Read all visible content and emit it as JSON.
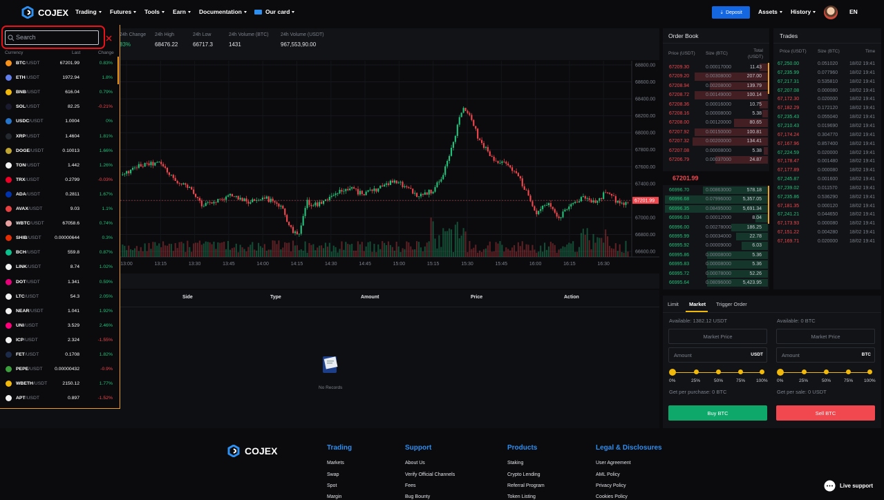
{
  "brand": {
    "name": "COJEX"
  },
  "nav": {
    "items": [
      "Trading",
      "Futures",
      "Tools",
      "Earn",
      "Documentation",
      "Our card"
    ],
    "deposit": "Deposit",
    "assets": "Assets",
    "history": "History",
    "lang": "EN"
  },
  "ticker": {
    "change_label": "24h Change",
    "change_value": "83%",
    "high_label": "24h High",
    "high_value": "68476.22",
    "low_label": "24h Low",
    "low_value": "66717.3",
    "volbtc_label": "24h Volume (BTC)",
    "volbtc_value": "1431",
    "volusdt_label": "24h Volume (USDT)",
    "volusdt_value": "967,553,90.00"
  },
  "chart": {
    "price_ticks": [
      "68800.00",
      "68600.00",
      "68400.00",
      "68200.00",
      "68000.00",
      "67800.00",
      "67600.00",
      "67400.00",
      "67200.00",
      "67000.00",
      "66800.00",
      "66600.00"
    ],
    "time_ticks": [
      "13:00",
      "13:15",
      "13:30",
      "13:45",
      "14:00",
      "14:15",
      "14:30",
      "14:45",
      "15:00",
      "15:15",
      "15:30",
      "15:45",
      "16:00",
      "16:15",
      "16:30"
    ],
    "last_price": "67201.99"
  },
  "orders_table": {
    "headers": [
      "Side",
      "Type",
      "Amount",
      "Price",
      "Action"
    ],
    "empty_text": "No Records"
  },
  "orderbook": {
    "title": "Order Book",
    "h_price": "Price (USDT)",
    "h_size": "Size (BTC)",
    "h_total": "Total (USDT)",
    "asks": [
      {
        "p": "67209.30",
        "s": "0.00017000",
        "t": "11.43",
        "d": 0.08
      },
      {
        "p": "67209.20",
        "s": "0.00308000",
        "t": "207.00",
        "d": 0.7
      },
      {
        "p": "67208.94",
        "s": "0.00208000",
        "t": "139.79",
        "d": 0.55
      },
      {
        "p": "67208.72",
        "s": "0.00149000",
        "t": "100.14",
        "d": 0.7
      },
      {
        "p": "67208.36",
        "s": "0.00016000",
        "t": "10.75",
        "d": 0.08
      },
      {
        "p": "67208.16",
        "s": "0.00008000",
        "t": "5.38",
        "d": 0.05
      },
      {
        "p": "67208.00",
        "s": "0.00120000",
        "t": "80.65",
        "d": 0.32
      },
      {
        "p": "67207.92",
        "s": "0.00150000",
        "t": "100.81",
        "d": 0.7
      },
      {
        "p": "67207.32",
        "s": "0.00200000",
        "t": "134.41",
        "d": 0.72
      },
      {
        "p": "67207.08",
        "s": "0.00008000",
        "t": "5.38",
        "d": 0.04
      },
      {
        "p": "67206.79",
        "s": "0.00037000",
        "t": "24.87",
        "d": 0.5
      }
    ],
    "mid": "67201.99",
    "bids": [
      {
        "p": "66996.70",
        "s": "0.00863000",
        "t": "578.18",
        "d": 0.62
      },
      {
        "p": "66996.68",
        "s": "0.07996000",
        "t": "5,357.05",
        "d": 0.98
      },
      {
        "p": "66996.35",
        "s": "0.08495000",
        "t": "5,691.34",
        "d": 0.98
      },
      {
        "p": "66996.03",
        "s": "0.00012000",
        "t": "8.04",
        "d": 0.12
      },
      {
        "p": "66996.00",
        "s": "0.00278000",
        "t": "186.25",
        "d": 0.35
      },
      {
        "p": "66995.99",
        "s": "0.00034000",
        "t": "22.78",
        "d": 0.3
      },
      {
        "p": "66995.92",
        "s": "0.00009000",
        "t": "6.03",
        "d": 0.25
      },
      {
        "p": "66995.86",
        "s": "0.00008000",
        "t": "5.36",
        "d": 0.58
      },
      {
        "p": "66995.83",
        "s": "0.00008000",
        "t": "5.36",
        "d": 0.58
      },
      {
        "p": "66995.72",
        "s": "0.00078000",
        "t": "52.26",
        "d": 0.58
      },
      {
        "p": "66995.64",
        "s": "0.08096000",
        "t": "5,423.95",
        "d": 0.58
      }
    ]
  },
  "trades": {
    "title": "Trades",
    "h_price": "Price (USDT)",
    "h_size": "Size (BTC)",
    "h_time": "Time",
    "rows": [
      {
        "p": "67,250.00",
        "s": "0.051020",
        "t": "18/02 19:41",
        "side": "buy"
      },
      {
        "p": "67,235.99",
        "s": "0.077960",
        "t": "18/02 19:41",
        "side": "buy"
      },
      {
        "p": "67,217.31",
        "s": "0.535810",
        "t": "18/02 19:41",
        "side": "buy"
      },
      {
        "p": "67,207.08",
        "s": "0.000080",
        "t": "18/02 19:41",
        "side": "buy"
      },
      {
        "p": "67,172.30",
        "s": "0.020000",
        "t": "18/02 19:41",
        "side": "sell"
      },
      {
        "p": "67,182.29",
        "s": "0.172120",
        "t": "18/02 19:41",
        "side": "sell"
      },
      {
        "p": "67,235.43",
        "s": "0.055040",
        "t": "18/02 19:41",
        "side": "buy"
      },
      {
        "p": "67,210.43",
        "s": "0.019690",
        "t": "18/02 19:41",
        "side": "buy"
      },
      {
        "p": "67,174.24",
        "s": "0.304770",
        "t": "18/02 19:41",
        "side": "sell"
      },
      {
        "p": "67,167.96",
        "s": "0.857400",
        "t": "18/02 19:41",
        "side": "sell"
      },
      {
        "p": "67,224.59",
        "s": "0.020000",
        "t": "18/02 19:41",
        "side": "buy"
      },
      {
        "p": "67,178.47",
        "s": "0.001480",
        "t": "18/02 19:41",
        "side": "sell"
      },
      {
        "p": "67,177.89",
        "s": "0.000080",
        "t": "18/02 19:41",
        "side": "sell"
      },
      {
        "p": "67,245.87",
        "s": "0.001600",
        "t": "18/02 19:41",
        "side": "buy"
      },
      {
        "p": "67,239.02",
        "s": "0.011570",
        "t": "18/02 19:41",
        "side": "buy"
      },
      {
        "p": "67,235.86",
        "s": "0.536290",
        "t": "18/02 19:41",
        "side": "buy"
      },
      {
        "p": "67,181.35",
        "s": "0.000120",
        "t": "18/02 19:41",
        "side": "sell"
      },
      {
        "p": "67,241.21",
        "s": "0.044650",
        "t": "18/02 19:41",
        "side": "buy"
      },
      {
        "p": "67,173.93",
        "s": "0.000080",
        "t": "18/02 19:41",
        "side": "sell"
      },
      {
        "p": "67,151.22",
        "s": "0.004280",
        "t": "18/02 19:41",
        "side": "sell"
      },
      {
        "p": "67,169.71",
        "s": "0.020000",
        "t": "18/02 19:41",
        "side": "sell"
      }
    ]
  },
  "trade_form": {
    "tabs": [
      "Limit",
      "Market",
      "Trigger Order"
    ],
    "active_tab": "Market",
    "buy": {
      "available": "Available: 1382.12  USDT",
      "market_price": "Market Price",
      "amount_ph": "Amount",
      "unit": "USDT",
      "get": "Get per purchase: 0  BTC",
      "button": "Buy BTC"
    },
    "sell": {
      "available": "Available: 0  BTC",
      "market_price": "Market Price",
      "amount_ph": "Amount",
      "unit": "BTC",
      "get": "Get per sale: 0  USDT",
      "button": "Sell BTC"
    },
    "percents": [
      "0%",
      "25%",
      "50%",
      "75%",
      "100%"
    ]
  },
  "dropdown": {
    "search_placeholder": "Search",
    "h_currency": "Currency",
    "h_last": "Last",
    "h_change": "Change",
    "coins": [
      {
        "sym": "BTC",
        "q": "/USDT",
        "last": "67201.99",
        "chg": "0.83%",
        "up": true,
        "color": "#f7931a"
      },
      {
        "sym": "ETH",
        "q": "/USDT",
        "last": "1972.94",
        "chg": "1.8%",
        "up": true,
        "color": "#627eea"
      },
      {
        "sym": "BNB",
        "q": "/USDT",
        "last": "616.04",
        "chg": "0.79%",
        "up": true,
        "color": "#f0b90b"
      },
      {
        "sym": "SOL",
        "q": "/USDT",
        "last": "82.25",
        "chg": "-0.21%",
        "up": false,
        "color": "#1a1a2e"
      },
      {
        "sym": "USDC",
        "q": "/USDT",
        "last": "1.0004",
        "chg": "0%",
        "up": true,
        "color": "#2775ca"
      },
      {
        "sym": "XRP",
        "q": "/USDT",
        "last": "1.4604",
        "chg": "1.81%",
        "up": true,
        "color": "#23292f"
      },
      {
        "sym": "DOGE",
        "q": "/USDT",
        "last": "0.10013",
        "chg": "1.66%",
        "up": true,
        "color": "#c2a633"
      },
      {
        "sym": "TON",
        "q": "/USDT",
        "last": "1.442",
        "chg": "1.26%",
        "up": true,
        "color": "#f2f2f2"
      },
      {
        "sym": "TRX",
        "q": "/USDT",
        "last": "0.2799",
        "chg": "-0.03%",
        "up": false,
        "color": "#ef0027"
      },
      {
        "sym": "ADA",
        "q": "/USDT",
        "last": "0.2811",
        "chg": "1.67%",
        "up": true,
        "color": "#0033ad"
      },
      {
        "sym": "AVAX",
        "q": "/USDT",
        "last": "9.03",
        "chg": "1.1%",
        "up": true,
        "color": "#e84142"
      },
      {
        "sym": "WBTC",
        "q": "/USDT",
        "last": "67058.6",
        "chg": "0.74%",
        "up": true,
        "color": "#e8a0a0"
      },
      {
        "sym": "SHIB",
        "q": "/USDT",
        "last": "0.00000644",
        "chg": "0.3%",
        "up": true,
        "color": "#e42d04"
      },
      {
        "sym": "BCH",
        "q": "/USDT",
        "last": "559.8",
        "chg": "0.87%",
        "up": true,
        "color": "#0ac18e"
      },
      {
        "sym": "LINK",
        "q": "/USDT",
        "last": "8.74",
        "chg": "1.02%",
        "up": true,
        "color": "#f2f2f2"
      },
      {
        "sym": "DOT",
        "q": "/USDT",
        "last": "1.341",
        "chg": "0.59%",
        "up": true,
        "color": "#e6007a"
      },
      {
        "sym": "LTC",
        "q": "/USDT",
        "last": "54.3",
        "chg": "2.05%",
        "up": true,
        "color": "#f2f2f2"
      },
      {
        "sym": "NEAR",
        "q": "/USDT",
        "last": "1.041",
        "chg": "1.92%",
        "up": true,
        "color": "#f2f2f2"
      },
      {
        "sym": "UNI",
        "q": "/USDT",
        "last": "3.529",
        "chg": "2.46%",
        "up": true,
        "color": "#ff007a"
      },
      {
        "sym": "ICP",
        "q": "/USDT",
        "last": "2.324",
        "chg": "-1.55%",
        "up": false,
        "color": "#f2f2f2"
      },
      {
        "sym": "FET",
        "q": "/USDT",
        "last": "0.1708",
        "chg": "1.82%",
        "up": true,
        "color": "#1d2b4a"
      },
      {
        "sym": "PEPE",
        "q": "/USDT",
        "last": "0.00000432",
        "chg": "-0.9%",
        "up": false,
        "color": "#3d9e3d"
      },
      {
        "sym": "WBETH",
        "q": "/USDT",
        "last": "2150.12",
        "chg": "1.77%",
        "up": true,
        "color": "#f0b90b"
      },
      {
        "sym": "APT",
        "q": "/USDT",
        "last": "0.897",
        "chg": "-1.52%",
        "up": false,
        "color": "#f2f2f2"
      }
    ]
  },
  "footer": {
    "brand": "COJEX",
    "cols": [
      {
        "title": "Trading",
        "links": [
          "Markets",
          "Swap",
          "Spot",
          "Margin"
        ]
      },
      {
        "title": "Support",
        "links": [
          "About Us",
          "Verify Official Channels",
          "Fees",
          "Bug Bounty"
        ]
      },
      {
        "title": "Products",
        "links": [
          "Staking",
          "Crypto Lending",
          "Referral Program",
          "Token Listing"
        ]
      },
      {
        "title": "Legal & Disclosures",
        "links": [
          "User Agreement",
          "AML Policy",
          "Privacy Policy",
          "Cookies Policy"
        ]
      }
    ],
    "live_support": "Live support"
  },
  "colors": {
    "up": "#22c27a",
    "down": "#f0484e",
    "accent": "#f0b90b",
    "brand_blue": "#1467e0"
  }
}
